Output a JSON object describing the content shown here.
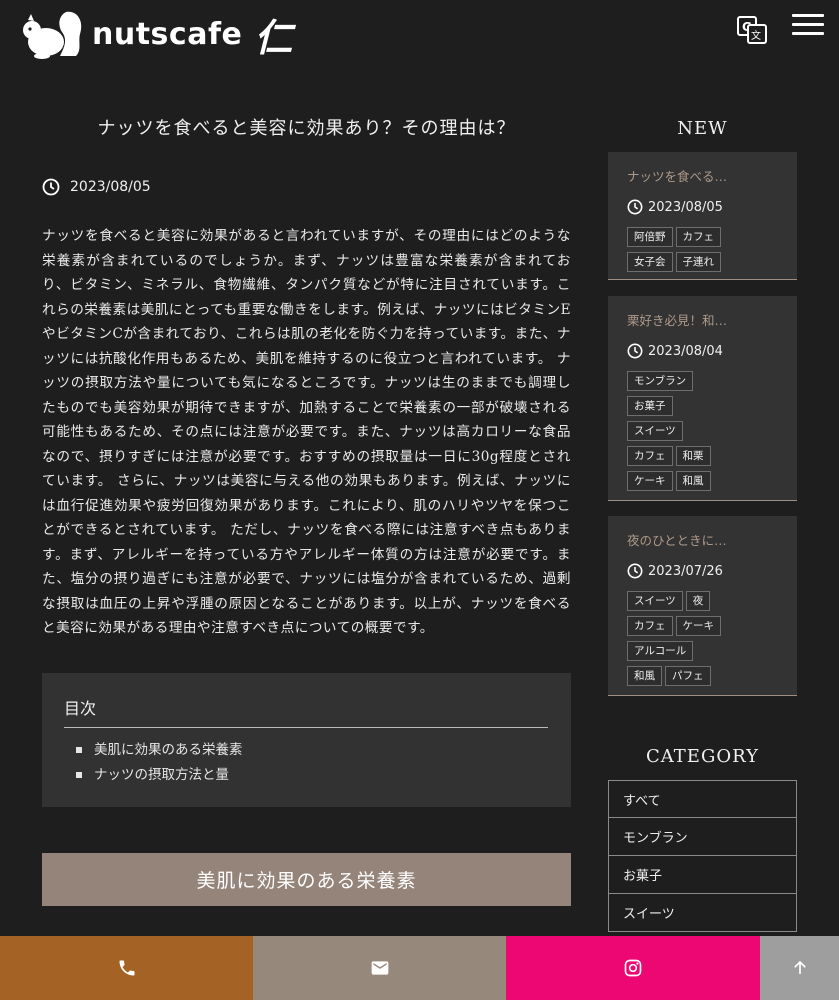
{
  "header": {
    "logo_text": "nutscafe",
    "logo_kanji": "仁"
  },
  "article": {
    "title": "ナッツを食べると美容に効果あり？その理由は？",
    "date": "2023/08/05",
    "body": "ナッツを食べると美容に効果があると言われていますが、その理由にはどのような栄養素が含まれているのでしょうか。まず、ナッツは豊富な栄養素が含まれており、ビタミン、ミネラル、食物繊維、タンパク質などが特に注目されています。これらの栄養素は美肌にとっても重要な働きをします。例えば、ナッツにはビタミンEやビタミンCが含まれており、これらは肌の老化を防ぐ力を持っています。また、ナッツには抗酸化作用もあるため、美肌を維持するのに役立つと言われています。 ナッツの摂取方法や量についても気になるところです。ナッツは生のままでも調理したものでも美容効果が期待できますが、加熱することで栄養素の一部が破壊される可能性もあるため、その点には注意が必要です。また、ナッツは高カロリーな食品なので、摂りすぎには注意が必要です。おすすめの摂取量は一日に30g程度とされています。 さらに、ナッツは美容に与える他の効果もあります。例えば、ナッツには血行促進効果や疲労回復効果があります。これにより、肌のハリやツヤを保つことができるとされています。 ただし、ナッツを食べる際には注意すべき点もあります。まず、アレルギーを持っている方やアレルギー体質の方は注意が必要です。また、塩分の摂り過ぎにも注意が必要で、ナッツには塩分が含まれているため、過剰な摂取は血圧の上昇や浮腫の原因となることがあります。以上が、ナッツを食べると美容に効果がある理由や注意すべき点についての概要です。",
    "toc": {
      "title": "目次",
      "items": [
        "美肌に効果のある栄養素",
        "ナッツの摂取方法と量"
      ]
    },
    "section_heading": "美肌に効果のある栄養素"
  },
  "sidebar": {
    "new_heading": "NEW",
    "posts": [
      {
        "title": "ナッツを食べる…",
        "date": "2023/08/05",
        "tag_rows": [
          [
            "阿倍野",
            "カフェ"
          ],
          [
            "女子会",
            "子連れ"
          ]
        ]
      },
      {
        "title": "栗好き必見！和…",
        "date": "2023/08/04",
        "tag_rows": [
          [
            "モンブラン"
          ],
          [
            "お菓子"
          ],
          [
            "スイーツ"
          ],
          [
            "カフェ",
            "和栗"
          ],
          [
            "ケーキ",
            "和風"
          ]
        ]
      },
      {
        "title": "夜のひとときに…",
        "date": "2023/07/26",
        "tag_rows": [
          [
            "スイーツ",
            "夜"
          ],
          [
            "カフェ",
            "ケーキ"
          ],
          [
            "アルコール"
          ],
          [
            "和風",
            "パフェ"
          ]
        ]
      }
    ],
    "category_heading": "CATEGORY",
    "categories": [
      "すべて",
      "モンブラン",
      "お菓子",
      "スイーツ"
    ]
  },
  "bottom_bar": {
    "phone_icon": "phone-icon",
    "mail_icon": "mail-icon",
    "instagram_icon": "instagram-icon",
    "top_icon": "arrow-up-icon",
    "colors": {
      "phone": "#a46224",
      "mail": "#97887c",
      "instagram": "#ec0772",
      "top": "#9e9e9e"
    }
  }
}
